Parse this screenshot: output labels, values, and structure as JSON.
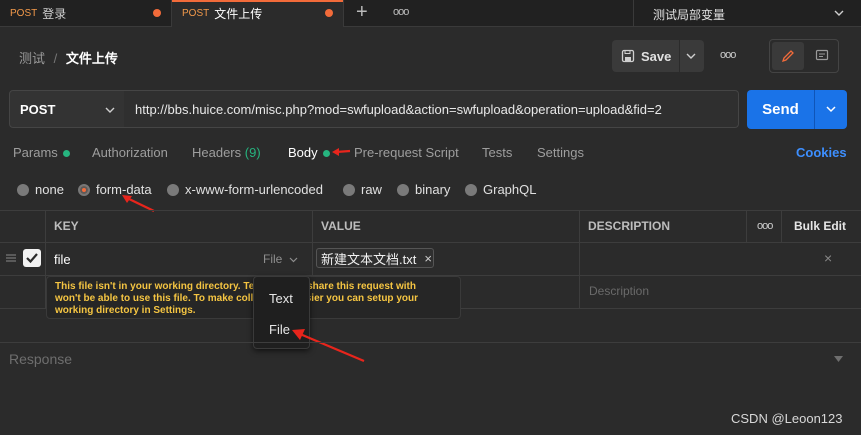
{
  "tabs": [
    {
      "method": "POST",
      "label": "登录",
      "unsaved": true
    },
    {
      "method": "POST",
      "label": "文件上传",
      "unsaved": true,
      "active": true
    }
  ],
  "add_tab_label": "+",
  "tab_more_label": "ooo",
  "environment": {
    "selected": "测试局部变量"
  },
  "breadcrumb": {
    "parent": "测试",
    "separator": "/",
    "current": "文件上传"
  },
  "header": {
    "save_label": "Save",
    "more_label": "ooo"
  },
  "request": {
    "method": "POST",
    "url": "http://bbs.huice.com/misc.php?mod=swfupload&action=swfupload&operation=upload&fid=2",
    "send_label": "Send"
  },
  "request_tabs": [
    {
      "label": "Params",
      "indicator": true
    },
    {
      "label": "Authorization"
    },
    {
      "label": "Headers",
      "count": "(9)"
    },
    {
      "label": "Body",
      "indicator": true,
      "active": true
    },
    {
      "label": "Pre-request Script"
    },
    {
      "label": "Tests"
    },
    {
      "label": "Settings"
    }
  ],
  "cookies_label": "Cookies",
  "body_modes": [
    {
      "label": "none"
    },
    {
      "label": "form-data",
      "selected": true
    },
    {
      "label": "x-www-form-urlencoded"
    },
    {
      "label": "raw"
    },
    {
      "label": "binary"
    },
    {
      "label": "GraphQL"
    }
  ],
  "table": {
    "headers": {
      "key": "KEY",
      "value": "VALUE",
      "description": "DESCRIPTION",
      "more": "ooo",
      "bulk_edit": "Bulk Edit"
    },
    "row": {
      "key": "file",
      "type": "File",
      "file_name": "新建文本文档.txt",
      "remove": "×"
    },
    "placeholder_description": "Description"
  },
  "tooltip": {
    "line1": "This file isn't in your working directory. Te",
    "line1b": "you share this request with",
    "line2": "won't be able to use this file. To make coll",
    "line2b": "asier you can setup your",
    "line3": "working directory in Settings."
  },
  "type_menu": [
    {
      "label": "Text"
    },
    {
      "label": "File",
      "selected": true
    }
  ],
  "response_label": "Response",
  "watermark": "CSDN @Leoon123",
  "colors": {
    "accent": "#f26b3a",
    "send": "#1a73e8",
    "green": "#26b47f",
    "warning": "#f5c542"
  }
}
